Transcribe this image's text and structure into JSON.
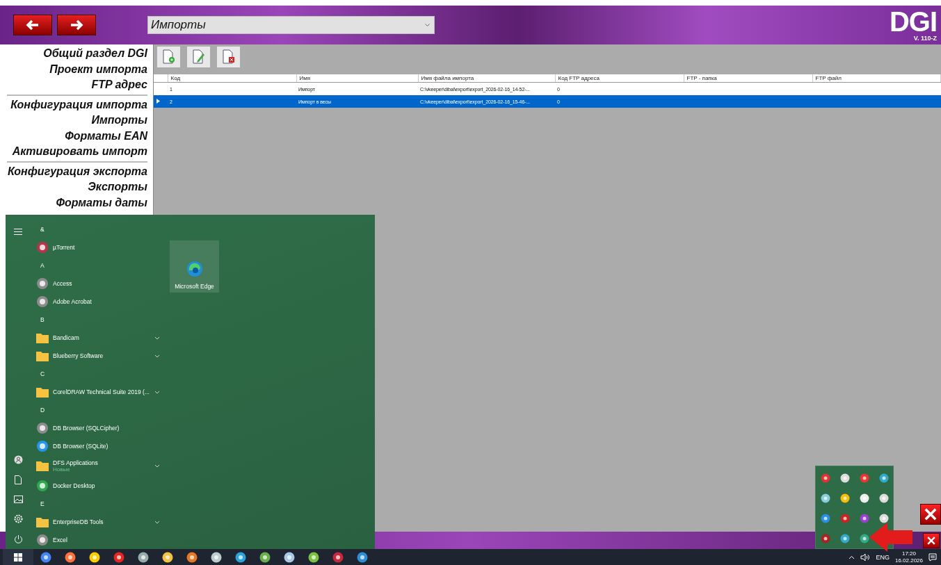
{
  "header": {
    "dropdown": {
      "value": "Импорты"
    },
    "logo": "DGI",
    "version": "V. 110-Z"
  },
  "sidebar": {
    "sections": [
      {
        "items": [
          "Общий раздел DGI",
          "Проект импорта",
          "FTP адрес"
        ]
      },
      {
        "items": [
          "Конфигурация импорта",
          "Импорты",
          "Форматы EAN",
          "Активировать импорт"
        ]
      },
      {
        "items": [
          "Конфигурация экспорта",
          "Экспорты",
          "Форматы даты"
        ]
      }
    ]
  },
  "table": {
    "columns": [
      "Код",
      "Имя",
      "Имя файла импорта",
      "Код FTP адреса",
      "FTP - папка",
      "FTP файл"
    ],
    "rows": [
      {
        "selected": false,
        "cells": [
          "1",
          "Импорт",
          "C:\\vkeeper\\dibal\\export\\export_2026-02-16_14-52-...",
          "0",
          "",
          ""
        ]
      },
      {
        "selected": true,
        "cells": [
          "2",
          "Импорт в весы",
          "C:\\vkeeper\\dibal\\export\\export_2026-02-16_15-46-...",
          "0",
          "",
          ""
        ]
      }
    ]
  },
  "start_menu": {
    "items": [
      {
        "kind": "letter",
        "label": "&"
      },
      {
        "kind": "app",
        "label": "µTorrent"
      },
      {
        "kind": "letter",
        "label": "A"
      },
      {
        "kind": "app",
        "label": "Access"
      },
      {
        "kind": "app",
        "label": "Adobe Acrobat"
      },
      {
        "kind": "letter",
        "label": "B"
      },
      {
        "kind": "folder",
        "label": "Bandicam",
        "expandable": true
      },
      {
        "kind": "folder",
        "label": "Blueberry Software",
        "expandable": true
      },
      {
        "kind": "letter",
        "label": "C"
      },
      {
        "kind": "folder",
        "label": "CorelDRAW Technical Suite 2019 (...",
        "expandable": true
      },
      {
        "kind": "letter",
        "label": "D"
      },
      {
        "kind": "app",
        "label": "DB Browser (SQLCipher)"
      },
      {
        "kind": "app",
        "label": "DB Browser (SQLite)"
      },
      {
        "kind": "folder",
        "label": "DFS Applications",
        "expandable": true,
        "note": "Новые"
      },
      {
        "kind": "app",
        "label": "Docker Desktop"
      },
      {
        "kind": "letter",
        "label": "E"
      },
      {
        "kind": "folder",
        "label": "EnterpriseDB Tools",
        "expandable": true
      },
      {
        "kind": "app",
        "label": "Excel"
      }
    ],
    "tiles": [
      {
        "label": "Microsoft Edge"
      }
    ]
  },
  "taskbar": {
    "language": "ENG",
    "time": "17:20",
    "date": "16.02.2026"
  }
}
